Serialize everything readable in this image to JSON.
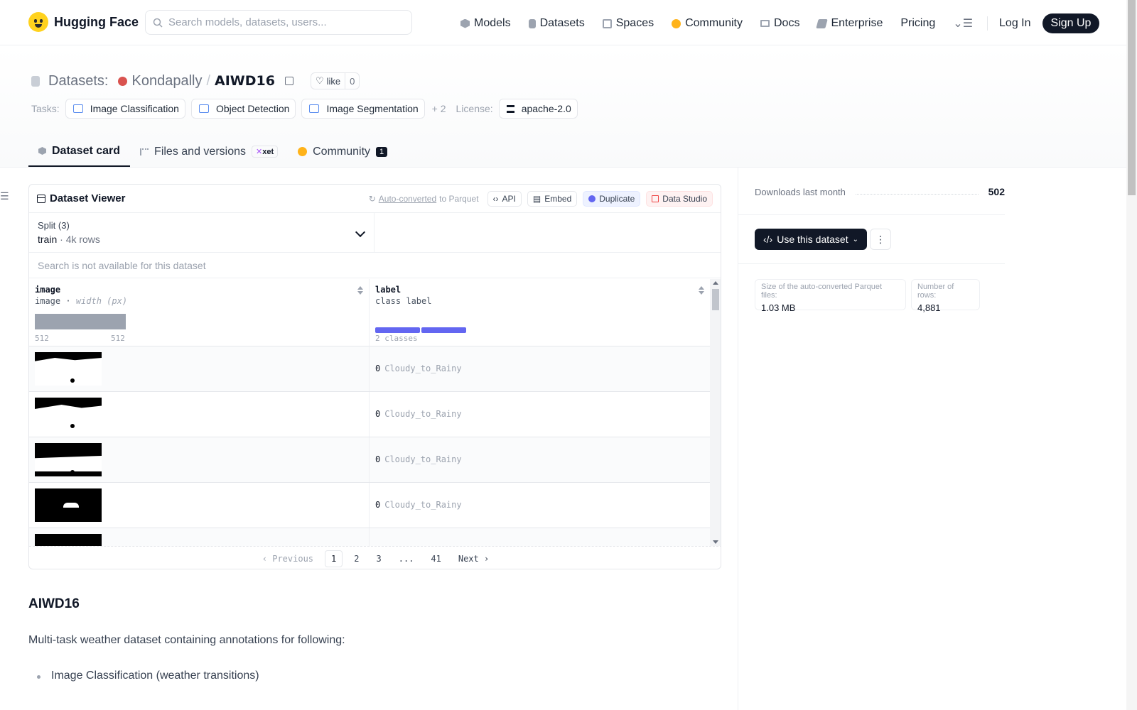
{
  "nav": {
    "brand": "Hugging Face",
    "search_placeholder": "Search models, datasets, users...",
    "links": [
      "Models",
      "Datasets",
      "Spaces",
      "Community",
      "Docs",
      "Enterprise",
      "Pricing"
    ],
    "login": "Log In",
    "signup": "Sign Up"
  },
  "repo": {
    "type_label": "Datasets:",
    "owner": "Kondapally",
    "name": "AIWD16",
    "like_label": "like",
    "like_count": "0"
  },
  "tags": {
    "tasks_label": "Tasks:",
    "tasks": [
      "Image Classification",
      "Object Detection",
      "Image Segmentation"
    ],
    "more": "+ 2",
    "license_label": "License:",
    "license": "apache-2.0"
  },
  "tabs": {
    "card": "Dataset card",
    "files": "Files and versions",
    "xet": "xet",
    "community": "Community",
    "community_count": "1"
  },
  "viewer": {
    "title": "Dataset Viewer",
    "auto_converted": "Auto-converted",
    "to_parquet": "to Parquet",
    "api": "API",
    "embed": "Embed",
    "duplicate": "Duplicate",
    "data_studio": "Data Studio",
    "split_label": "Split (3)",
    "split_value": "train",
    "split_rows": "4k rows",
    "search_na": "Search is not available for this dataset",
    "columns": [
      {
        "name": "image",
        "type": "image",
        "type_extra": "width (px)",
        "min": "512",
        "max": "512"
      },
      {
        "name": "label",
        "type": "class label",
        "classes": "2 classes"
      }
    ],
    "rows": [
      {
        "label_id": "0",
        "label_name": "Cloudy_to_Rainy"
      },
      {
        "label_id": "0",
        "label_name": "Cloudy_to_Rainy"
      },
      {
        "label_id": "0",
        "label_name": "Cloudy_to_Rainy"
      },
      {
        "label_id": "0",
        "label_name": "Cloudy_to_Rainy"
      }
    ],
    "pager": {
      "prev": "Previous",
      "pages": [
        "1",
        "2",
        "3",
        "...",
        "41"
      ],
      "next": "Next"
    }
  },
  "readme": {
    "heading": "AIWD16",
    "intro": "Multi-task weather dataset containing annotations for following:",
    "item1": "Image Classification (weather transitions)"
  },
  "sidebar": {
    "downloads_label": "Downloads last month",
    "downloads_value": "502",
    "use_dataset": "Use this dataset",
    "parquet_size_label": "Size of the auto-converted Parquet files:",
    "parquet_size": "1.03 MB",
    "rows_label": "Number of rows:",
    "rows_value": "4,881"
  }
}
